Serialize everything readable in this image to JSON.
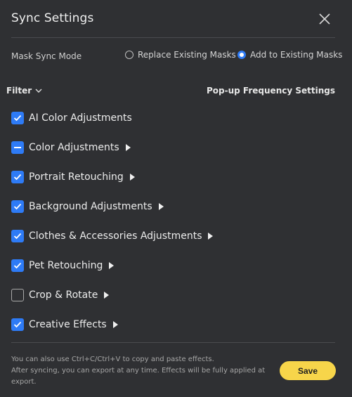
{
  "title": "Sync Settings",
  "mask_sync": {
    "label": "Mask Sync Mode",
    "options": [
      {
        "label": "Replace Existing Masks",
        "selected": false
      },
      {
        "label": "Add to Existing Masks",
        "selected": true
      }
    ]
  },
  "filter_label": "Filter",
  "popup_label": "Pop-up Frequency Settings",
  "items": [
    {
      "label": "AI Color Adjustments",
      "state": "checked",
      "expandable": false
    },
    {
      "label": "Color Adjustments",
      "state": "partial",
      "expandable": true
    },
    {
      "label": "Portrait Retouching",
      "state": "checked",
      "expandable": true
    },
    {
      "label": "Background Adjustments",
      "state": "checked",
      "expandable": true
    },
    {
      "label": "Clothes & Accessories Adjustments",
      "state": "checked",
      "expandable": true
    },
    {
      "label": "Pet Retouching",
      "state": "checked",
      "expandable": true
    },
    {
      "label": "Crop & Rotate",
      "state": "unchecked",
      "expandable": true
    },
    {
      "label": "Creative Effects",
      "state": "checked",
      "expandable": true
    }
  ],
  "notes": {
    "line1": "You can also use Ctrl+C/Ctrl+V to copy and paste effects.",
    "line2": "After syncing, you can export at any time. Effects will be fully applied at export."
  },
  "save_label": "Save",
  "colors": {
    "accent": "#2e7bf6",
    "save_button": "#f7d54a",
    "background": "#2f3033"
  }
}
